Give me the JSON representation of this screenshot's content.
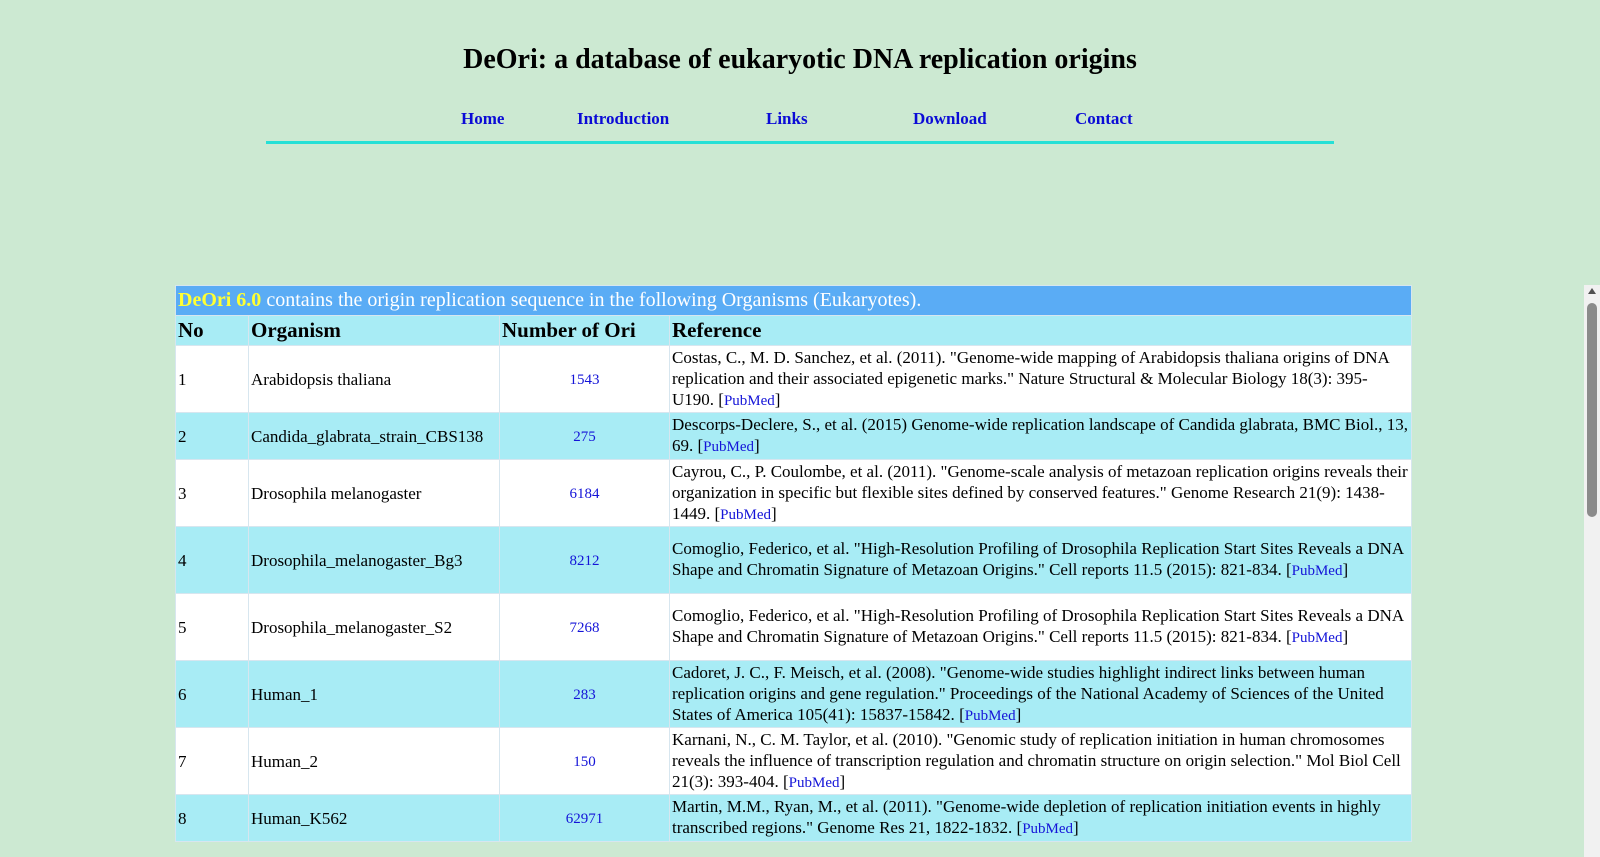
{
  "header": {
    "title": "DeOri: a database of eukaryotic DNA replication origins"
  },
  "nav": [
    {
      "label": "Home"
    },
    {
      "label": "Introduction"
    },
    {
      "label": "Links"
    },
    {
      "label": "Download"
    },
    {
      "label": "Contact"
    }
  ],
  "banner": {
    "version": "DeOri 6.0",
    "text": " contains the origin replication sequence in the following Organisms (Eukaryotes)."
  },
  "table": {
    "headers": {
      "no": "No",
      "organism": "Organism",
      "count": "Number of Ori",
      "reference": "Reference"
    },
    "link_label": "PubMed",
    "rows": [
      {
        "no": "1",
        "organism": "Arabidopsis thaliana",
        "count": "1543",
        "ref": "Costas, C., M. D. Sanchez, et al. (2011). \"Genome-wide mapping of Arabidopsis thaliana origins of DNA replication and their associated epigenetic marks.\" Nature Structural & Molecular Biology 18(3): 395-U190."
      },
      {
        "no": "2",
        "organism": "Candida_glabrata_strain_CBS138",
        "count": "275",
        "ref": "Descorps-Declere, S., et al. (2015) Genome-wide replication landscape of Candida glabrata, BMC Biol., 13, 69."
      },
      {
        "no": "3",
        "organism": "Drosophila melanogaster",
        "count": "6184",
        "ref": "Cayrou, C., P. Coulombe, et al. (2011). \"Genome-scale analysis of metazoan replication origins reveals their organization in specific but flexible sites defined by conserved features.\" Genome Research 21(9): 1438-1449."
      },
      {
        "no": "4",
        "organism": "Drosophila_melanogaster_Bg3",
        "count": "8212",
        "ref": "Comoglio, Federico, et al. \"High-Resolution Profiling of Drosophila Replication Start Sites Reveals a DNA Shape and Chromatin Signature of Metazoan Origins.\" Cell reports 11.5 (2015): 821-834."
      },
      {
        "no": "5",
        "organism": "Drosophila_melanogaster_S2",
        "count": "7268",
        "ref": "Comoglio, Federico, et al. \"High-Resolution Profiling of Drosophila Replication Start Sites Reveals a DNA Shape and Chromatin Signature of Metazoan Origins.\" Cell reports 11.5 (2015): 821-834."
      },
      {
        "no": "6",
        "organism": "Human_1",
        "count": "283",
        "ref": "Cadoret, J. C., F. Meisch, et al. (2008). \"Genome-wide studies highlight indirect links between human replication origins and gene regulation.\" Proceedings of the National Academy of Sciences of the United States of America 105(41): 15837-15842."
      },
      {
        "no": "7",
        "organism": "Human_2",
        "count": "150",
        "ref": "Karnani, N., C. M. Taylor, et al. (2010). \"Genomic study of replication initiation in human chromosomes reveals the influence of transcription regulation and chromatin structure on origin selection.\" Mol Biol Cell 21(3): 393-404."
      },
      {
        "no": "8",
        "organism": "Human_K562",
        "count": "62971",
        "ref": "Martin, M.M., Ryan, M., et al. (2011). \"Genome-wide depletion of replication initiation events in highly transcribed regions.\" Genome Res 21, 1822-1832."
      }
    ]
  }
}
